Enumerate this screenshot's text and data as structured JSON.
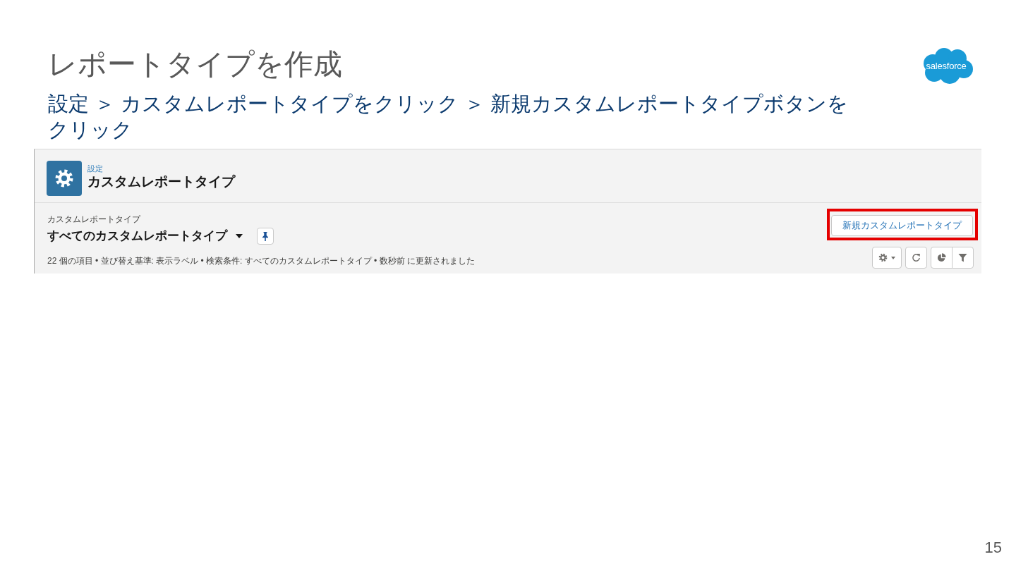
{
  "slide": {
    "title": "レポートタイプを作成",
    "instruction": "設定 ＞ カスタムレポートタイプをクリック ＞ 新規カスタムレポートタイプボタンをクリック",
    "logo": "salesforce",
    "page_number": "15"
  },
  "screenshot": {
    "header": {
      "breadcrumb": "設定",
      "title": "カスタムレポートタイプ"
    },
    "list_view": {
      "object_label": "カスタムレポートタイプ",
      "view_name": "すべてのカスタムレポートタイプ",
      "status": "22 個の項目 • 並び替え基準: 表示ラベル • 検索条件: すべてのカスタムレポートタイプ • 数秒前 に更新されました",
      "new_button": {
        "label": "新規カスタムレポートタイプ",
        "highlighted": true
      }
    }
  }
}
